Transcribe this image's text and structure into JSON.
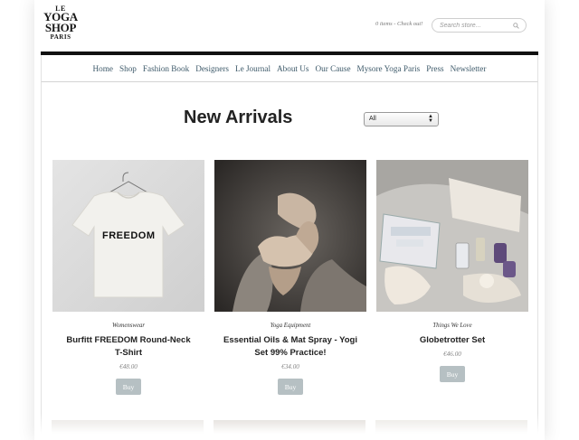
{
  "header": {
    "logo": {
      "line1": "LE",
      "line2": "YOGA",
      "line3": "SHOP",
      "line4": "PARIS"
    },
    "cart_status": "0 items - Check out!",
    "search_placeholder": "Search store..."
  },
  "nav": {
    "items": [
      {
        "label": "Home"
      },
      {
        "label": "Shop"
      },
      {
        "label": "Fashion Book"
      },
      {
        "label": "Designers"
      },
      {
        "label": "Le Journal"
      },
      {
        "label": "About Us"
      },
      {
        "label": "Our Cause"
      },
      {
        "label": "Mysore Yoga Paris"
      },
      {
        "label": "Press"
      },
      {
        "label": "Newsletter"
      }
    ]
  },
  "main": {
    "title": "New Arrivals",
    "filter": {
      "selected": "All"
    },
    "products": [
      {
        "category": "Womenswear",
        "name": "Burfitt FREEDOM Round-Neck T-Shirt",
        "price": "€48.00",
        "button": "Buy",
        "print_text": "FREEDOM"
      },
      {
        "category": "Yoga Equipment",
        "name": "Essential Oils & Mat Spray - Yogi Set 99% Practice!",
        "price": "€34.00",
        "button": "Buy"
      },
      {
        "category": "Things We Love",
        "name": "Globetrotter Set",
        "price": "€46.00",
        "button": "Buy"
      }
    ]
  },
  "colors": {
    "nav_link": "#3e5a6a",
    "top_bar": "#111111",
    "buy_button": "#b6c0c3"
  }
}
